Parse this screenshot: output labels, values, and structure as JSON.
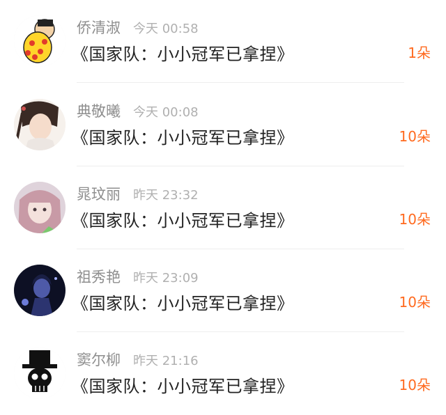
{
  "gift_color": "#ff6a1f",
  "rows": [
    {
      "name": "侨清淑",
      "time": "今天 00:58",
      "message": "《国家队：小小冠军已拿捏》",
      "gift": "1朵",
      "avatar": "cartoon-boy-avatar-icon"
    },
    {
      "name": "典敬曦",
      "time": "今天 00:08",
      "message": "《国家队：小小冠军已拿捏》",
      "gift": "10朵",
      "avatar": "ancient-girl-avatar-icon"
    },
    {
      "name": "晁玟丽",
      "time": "昨天 23:32",
      "message": "《国家队：小小冠军已拿捏》",
      "gift": "10朵",
      "avatar": "pink-hair-girl-avatar-icon"
    },
    {
      "name": "祖秀艳",
      "time": "昨天 23:09",
      "message": "《国家队：小小冠军已拿捏》",
      "gift": "10朵",
      "avatar": "dark-anime-avatar-icon"
    },
    {
      "name": "窦尔柳",
      "time": "昨天 21:16",
      "message": "《国家队：小小冠军已拿捏》",
      "gift": "10朵",
      "avatar": "skull-top-hat-avatar-icon"
    }
  ]
}
